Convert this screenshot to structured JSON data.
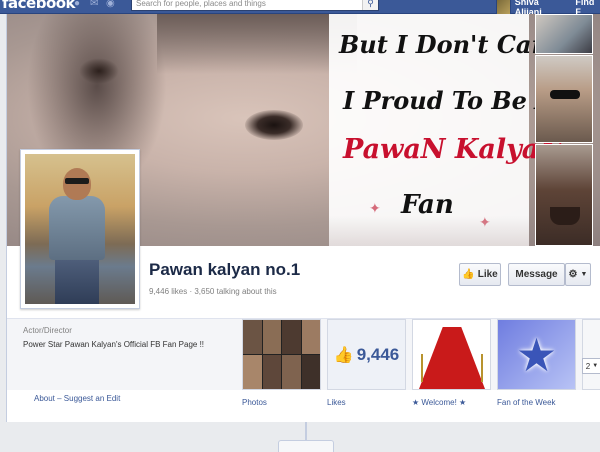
{
  "topbar": {
    "logo": "facebook",
    "search_placeholder": "Search for people, places and things",
    "user_name": "Shiva Alijani",
    "find_link": "Find F"
  },
  "cover": {
    "quote_lines": [
      "But I Don't Care",
      "I Proud To Be A",
      "PawaN KalyaN",
      "Fan"
    ]
  },
  "page": {
    "name": "Pawan kalyan no.1",
    "stats": "9,446 likes · 3,650 talking about this",
    "like_label": "Like",
    "message_label": "Message"
  },
  "about": {
    "category": "Actor/Director",
    "description": "Power Star Pawan Kalyan's Official FB Fan Page !!",
    "link": "About – Suggest an Edit"
  },
  "tiles": {
    "photos_label": "Photos",
    "likes_count": "9,446",
    "likes_label": "Likes",
    "welcome_label": "★ Welcome! ★",
    "fan_label": "Fan of the Week",
    "more_count": "2"
  },
  "icons": {
    "jewels": [
      "friends-icon",
      "messages-icon",
      "notifications-icon"
    ],
    "search": "magnifier-icon",
    "like": "thumbs-up-icon",
    "gear": "gear-icon",
    "star": "star-icon"
  },
  "colors": {
    "brand": "#3b5998",
    "quote_accent": "#c8102e"
  }
}
